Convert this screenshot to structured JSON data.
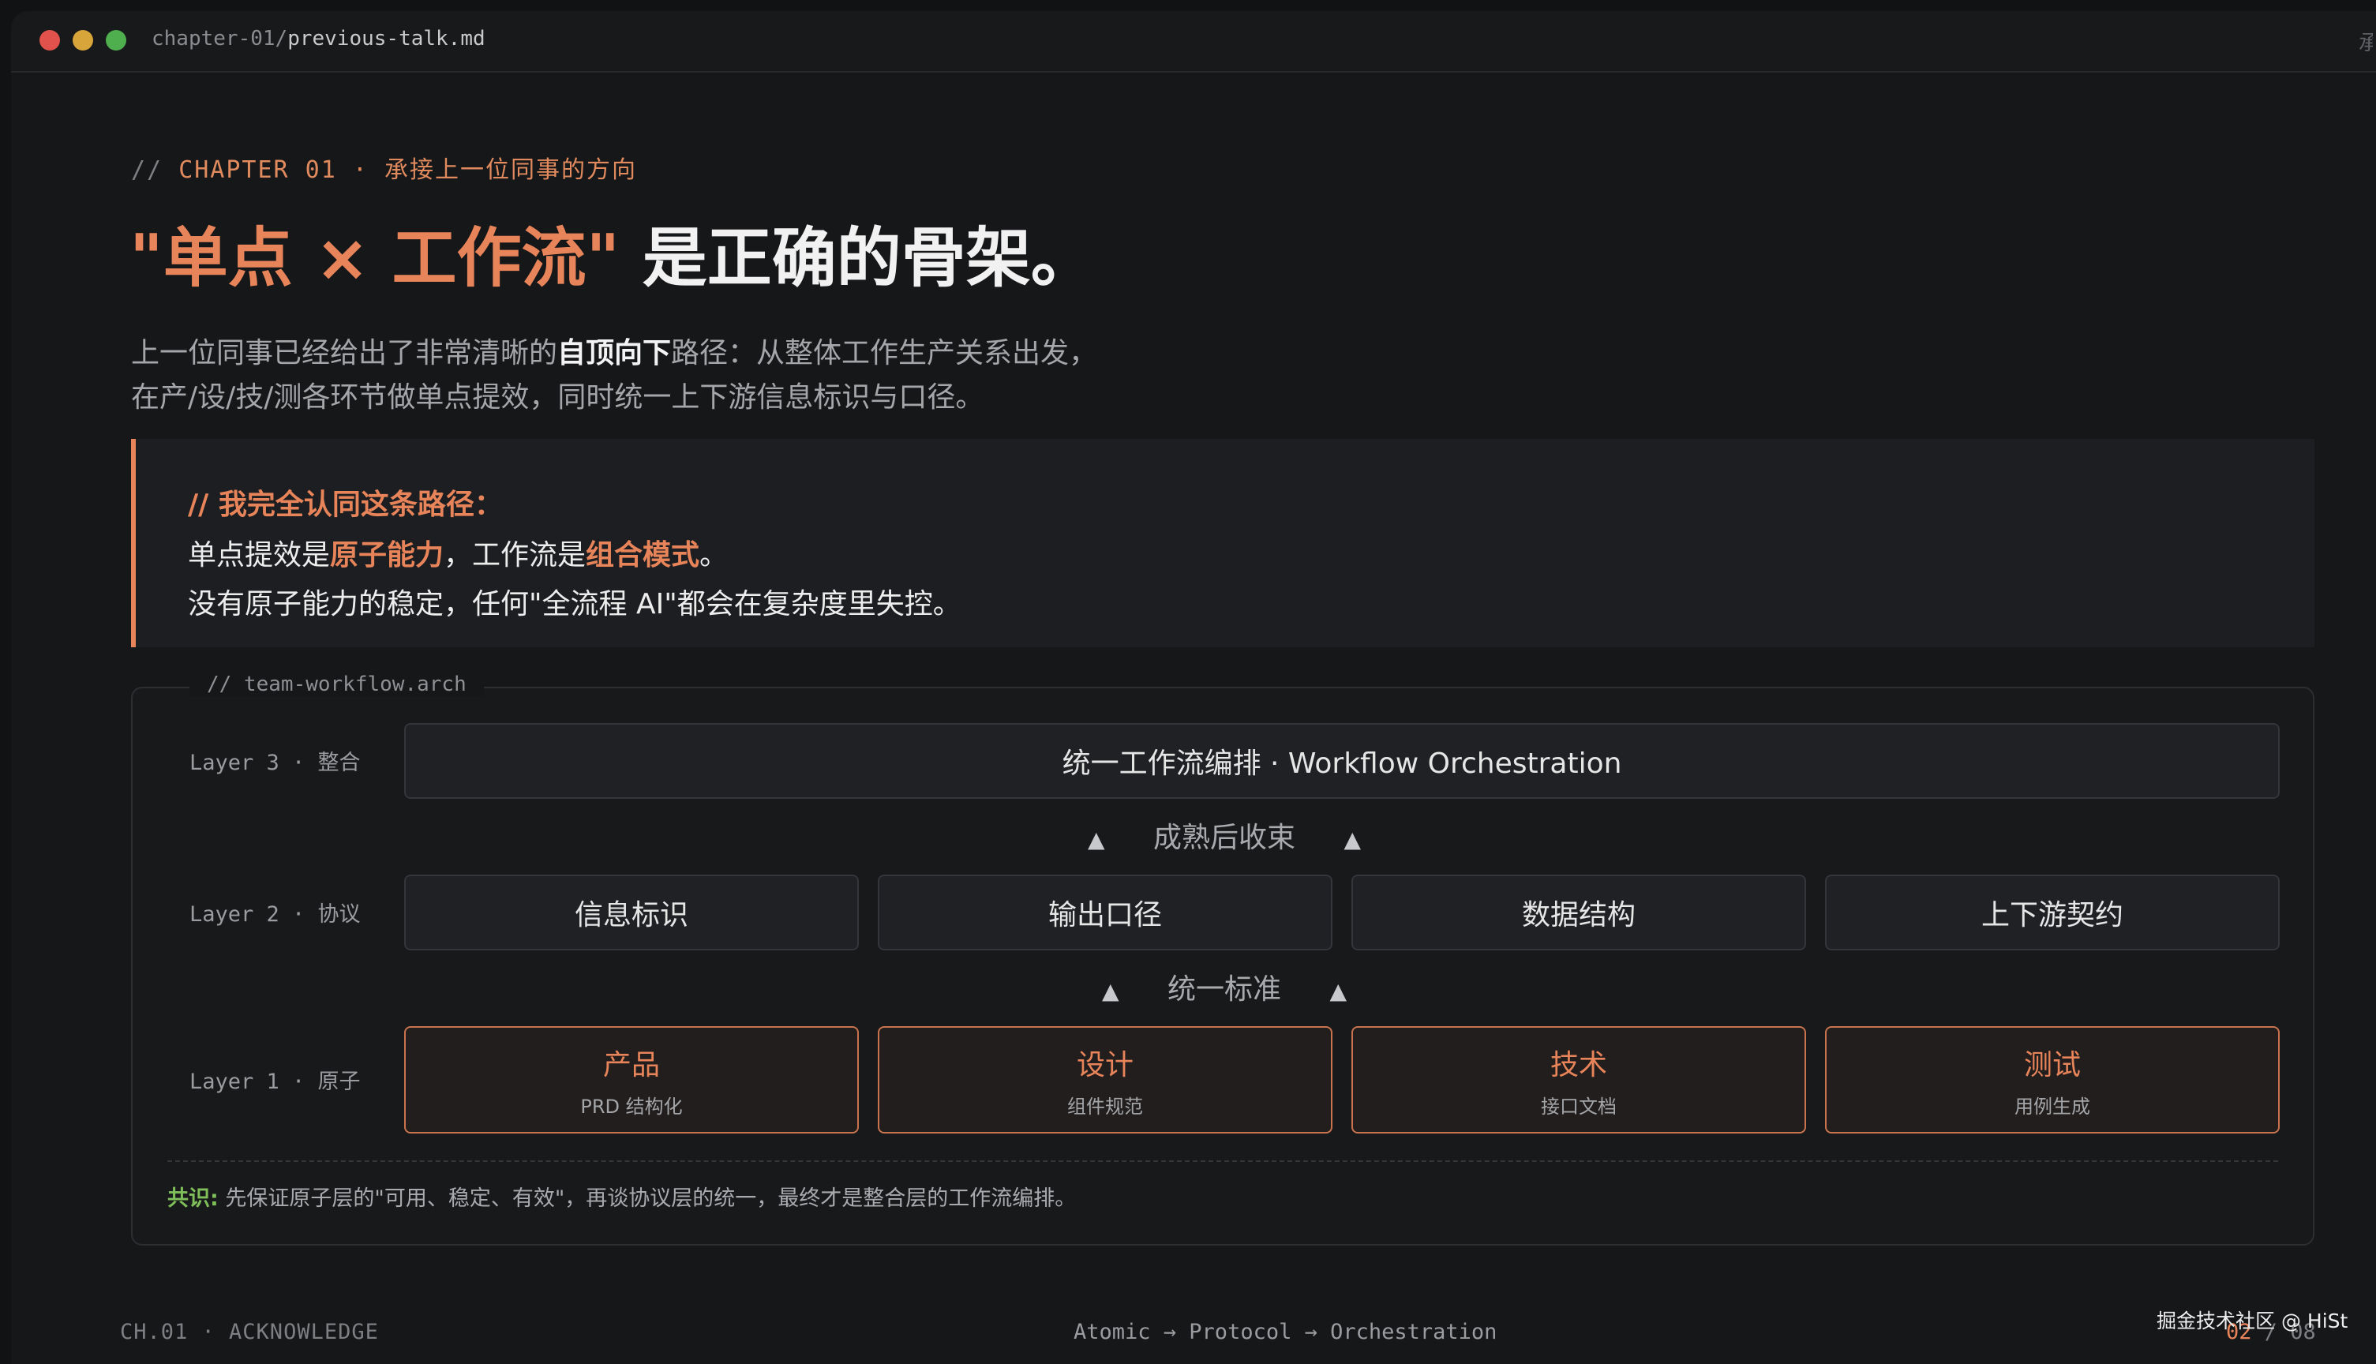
{
  "window": {
    "path_dir": "chapter-01/",
    "path_file": "previous-talk.md",
    "title_right": "承"
  },
  "kicker": {
    "slash": "//",
    "text": "CHAPTER 01 · 承接上一位同事的方向"
  },
  "headline": {
    "accent": "\"单点 × 工作流\"",
    "rest": " 是正确的骨架。"
  },
  "intro": {
    "line1_pre": "上一位同事已经给出了非常清晰的",
    "line1_bold": "自顶向下",
    "line1_post": "路径：从整体工作生产关系出发，",
    "line2": "在产/设/技/测各环节做单点提效，同时统一上下游信息标识与口径。"
  },
  "quote": {
    "title": "//  我完全认同这条路径：",
    "line1_pre": "单点提效是",
    "line1_hl1": "原子能力",
    "line1_mid": "，工作流是",
    "line1_hl2": "组合模式",
    "line1_post": "。",
    "line2": "没有原子能力的稳定，任何\"全流程 AI\"都会在复杂度里失控。"
  },
  "arch": {
    "label": "// team-workflow.arch",
    "layer3": {
      "label": "Layer 3 · 整合",
      "box": "统一工作流编排 · Workflow Orchestration"
    },
    "connector_upper": "成熟后收束",
    "layer2": {
      "label": "Layer 2 · 协议",
      "boxes": [
        "信息标识",
        "输出口径",
        "数据结构",
        "上下游契约"
      ]
    },
    "connector_lower": "统一标准",
    "layer1": {
      "label": "Layer 1 · 原子",
      "boxes": [
        {
          "main": "产品",
          "sub": "PRD 结构化"
        },
        {
          "main": "设计",
          "sub": "组件规范"
        },
        {
          "main": "技术",
          "sub": "接口文档"
        },
        {
          "main": "测试",
          "sub": "用例生成"
        }
      ]
    },
    "consensus": {
      "label": "共识:",
      "text": " 先保证原子层的\"可用、稳定、有效\"，再谈协议层的统一，最终才是整合层的工作流编排。"
    }
  },
  "footer": {
    "left": "CH.01 · ACKNOWLEDGE",
    "center": "Atomic → Protocol → Orchestration",
    "page_current": "02",
    "page_sep": " / ",
    "page_total": "08",
    "watermark": "掘金技术社区 @ HiSt"
  },
  "colors": {
    "accent": "#e8845a",
    "consensus": "#7fbf5a",
    "background": "#161719"
  }
}
